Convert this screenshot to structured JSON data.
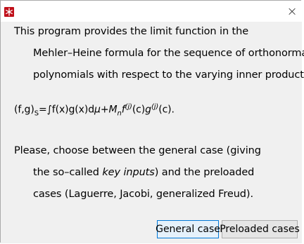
{
  "window": {
    "close_glyph": "×",
    "app_icon": "snowflake-icon",
    "accent_color": "#c0101a"
  },
  "message": {
    "line1": "This program provides the limit function in the",
    "line2": "Mehler–Heine formula for the sequence of orthonormal",
    "line3": "polynomials with respect to the varying inner product",
    "formula_parts": {
      "lhs": "(f,g)",
      "lhs_sub": "S",
      "integral": "=∫f(x)g(x)d",
      "mu": "μ",
      "plus": "+",
      "M": "M",
      "n": "n",
      "f": "f",
      "sup1": "(j)",
      "c1": "(c)",
      "g": "g",
      "sup2": "(j)",
      "c2": "(c)."
    },
    "line5": "Please, choose between the general case (giving",
    "line6_prefix": "the so–called ",
    "line6_italic": "key inputs",
    "line6_suffix": ") and the preloaded",
    "line7": "cases (Laguerre, Jacobi, generalized Freud)."
  },
  "buttons": {
    "general_label": "General case",
    "preloaded_label": "Preloaded cases"
  }
}
